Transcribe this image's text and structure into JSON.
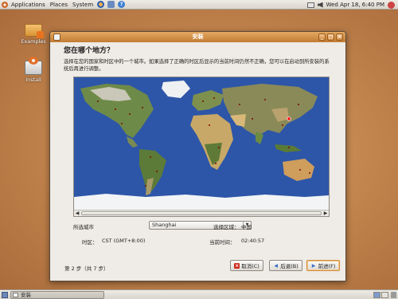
{
  "top_panel": {
    "menus": [
      "Applications",
      "Places",
      "System"
    ],
    "clock": "Wed Apr 18,  6:40 PM"
  },
  "desktop": {
    "icons": [
      {
        "label": "Examples"
      },
      {
        "label": "Install"
      }
    ]
  },
  "window": {
    "title": "安装",
    "heading": "您在哪个地方？",
    "instruction": "选择在您的国家和时区中的一个城市。如果选择了正确的时区后显示的当前时间仍然不正确，您可以在启动到所安装的系统后再进行调整。",
    "selected_city_label": "所选城市",
    "selected_city_value": "Shanghai",
    "selected_region_label": "选择区域：",
    "selected_region_value": "中国",
    "timezone_label": "时区：",
    "timezone_value": "CST (GMT+8:00)",
    "current_time_label": "当前时间：",
    "current_time_value": "02:40:57",
    "step_text": "第 2 步（共 7 步）",
    "buttons": {
      "cancel": "取消(C)",
      "back": "后退(B)",
      "forward": "前进(F)"
    }
  },
  "taskbar": {
    "task_label": "安装"
  }
}
